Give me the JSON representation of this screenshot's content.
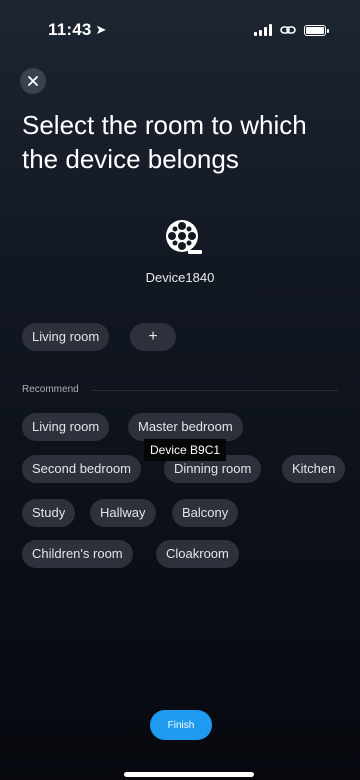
{
  "status_bar": {
    "time": "11:43"
  },
  "title": "Select the room to which the device belongs",
  "device": {
    "name": "Device1840",
    "icon": "film-reel-icon"
  },
  "selected_rooms": [
    {
      "label": "Living room"
    }
  ],
  "add_label": "+",
  "recommend": {
    "label": "Recommend",
    "items": [
      {
        "label": "Living room"
      },
      {
        "label": "Master bedroom"
      },
      {
        "label": "Second bedroom"
      },
      {
        "label": "Dinning room"
      },
      {
        "label": "Kitchen"
      },
      {
        "label": "Study"
      },
      {
        "label": "Hallway"
      },
      {
        "label": "Balcony"
      },
      {
        "label": "Children's room"
      },
      {
        "label": "Cloakroom"
      }
    ]
  },
  "tooltip": "Device B9C1",
  "finish_label": "Finish",
  "colors": {
    "accent": "#1e9bf0",
    "chip_bg": "#2c313b",
    "background_top": "#1d2532",
    "background_bottom": "#07090f"
  }
}
